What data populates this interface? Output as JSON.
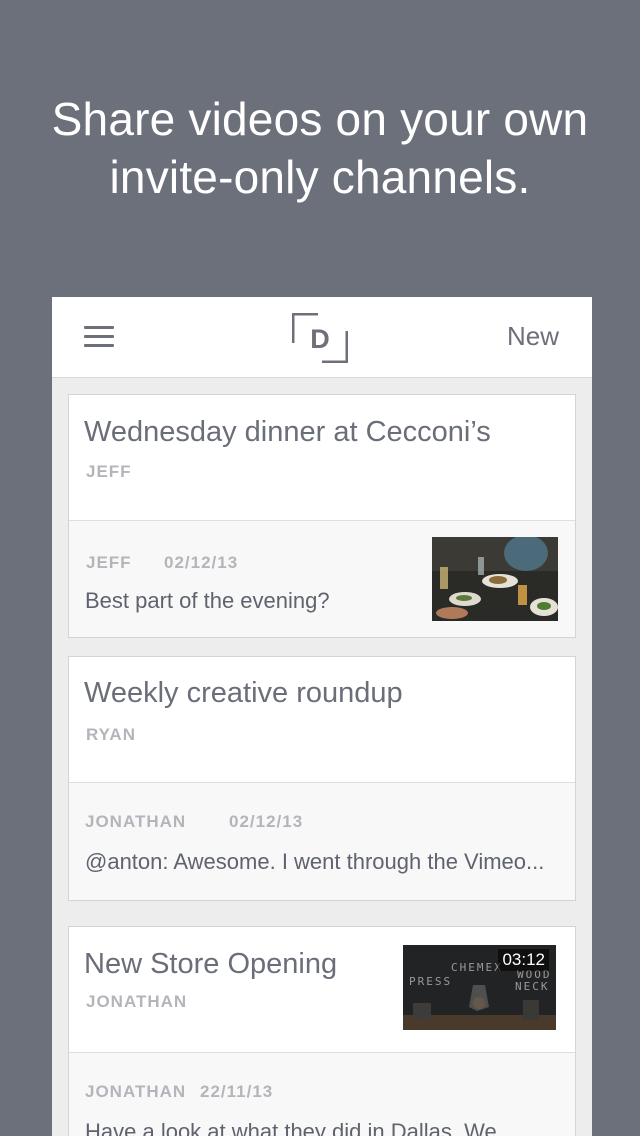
{
  "headline": {
    "line1": "Share videos on your own",
    "line2": "invite-only channels."
  },
  "app_bar": {
    "menu_icon": "hamburger-menu-icon",
    "logo_letter": "D",
    "new_label": "New"
  },
  "threads": [
    {
      "title": "Wednesday dinner at Cecconi’s",
      "author": "JEFF",
      "latest": {
        "author": "JEFF",
        "date": "02/12/13",
        "message": "Best part of the evening?",
        "thumbnail": "dinner-photo"
      }
    },
    {
      "title": "Weekly creative roundup",
      "author": "RYAN",
      "latest": {
        "author": "JONATHAN",
        "date": "02/12/13",
        "message": "@anton: Awesome. I went through the Vimeo..."
      }
    },
    {
      "title": "New Store Opening",
      "author": "JONATHAN",
      "video_duration": "03:12",
      "video_overlay_text": [
        "CHEMEX",
        "PRESS",
        "WOOD",
        "NECK"
      ],
      "latest": {
        "author": "JONATHAN",
        "date": "22/11/13",
        "message": "Have a look at what they did in Dallas. We"
      }
    }
  ],
  "colors": {
    "background": "#6c707b",
    "card_text": "#6a6e79",
    "meta_text": "#b3b5bb"
  }
}
